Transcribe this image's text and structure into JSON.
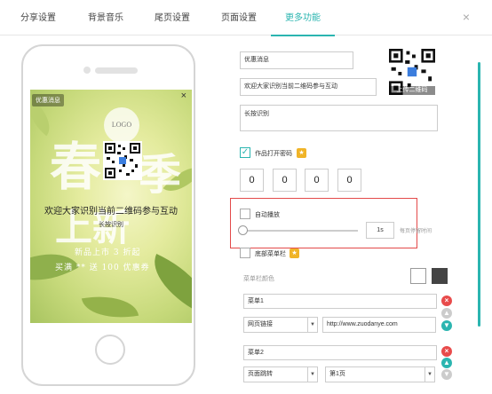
{
  "tabs": [
    {
      "label": "分享设置"
    },
    {
      "label": "背景音乐"
    },
    {
      "label": "尾页设置"
    },
    {
      "label": "页面设置"
    },
    {
      "label": "更多功能"
    }
  ],
  "close_icon": "×",
  "preview": {
    "tag": "优惠消息",
    "close": "×",
    "logo": "LOGO",
    "title_char1": "春",
    "title_char2": "季",
    "title_char3": "上新",
    "caption": "欢迎大家识别当前二维码参与互动",
    "subcaption": "长按识别",
    "promo_line1": "新品上市 3 折起",
    "promo_line2": "买满 ** 送 100 优惠券"
  },
  "form": {
    "title_value": "优惠消息",
    "desc_value": "欢迎大家识别当前二维码参与互动",
    "hint_value": "长按识别",
    "qr_label": "上传二维码",
    "password_label": "作品打开密码",
    "password_enabled": true,
    "password_digits": [
      "0",
      "0",
      "0",
      "0"
    ],
    "autoplay_label": "自动播放",
    "autoplay_enabled": false,
    "autoplay_seconds": "1s",
    "autoplay_hint": "每页停留时间",
    "menu_bar_label": "底部菜单栏",
    "menu_bar_enabled": false,
    "menu_color_label": "菜单栏颜色",
    "menu_items": [
      {
        "name": "菜单1",
        "type": "网页链接",
        "target": "http://www.zuodanye.com"
      },
      {
        "name": "菜单2",
        "type": "页面跳转",
        "target": "第1页"
      }
    ],
    "premium_badge": "★"
  },
  "colors": {
    "accent": "#2bb5b0",
    "highlight_border": "#e34a4a",
    "swatch_white": "#ffffff",
    "swatch_dark": "#444444",
    "btn_delete": "#e84b4b",
    "btn_up": "#2bb5b0",
    "btn_disabled": "#cccccc",
    "badge": "#f0b428"
  }
}
